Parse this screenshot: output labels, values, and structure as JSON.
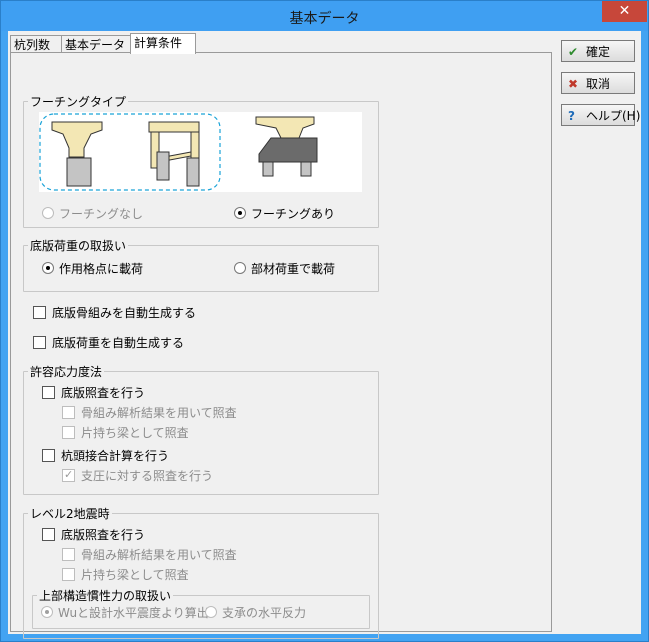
{
  "window": {
    "title": "基本データ",
    "close_glyph": "✕"
  },
  "tabs": [
    {
      "label": "杭列数"
    },
    {
      "label": "基本データ"
    },
    {
      "label": "計算条件"
    }
  ],
  "footing_type": {
    "title": "フーチングタイプ",
    "opt_none": "フーチングなし",
    "opt_yes": "フーチングあり",
    "selected": "フーチングあり"
  },
  "slab_load": {
    "title": "底版荷重の取扱い",
    "opt_node": "作用格点に載荷",
    "opt_member": "部材荷重で載荷",
    "selected": "作用格点に載荷"
  },
  "auto": {
    "frame": "底版骨組みを自動生成する",
    "load": "底版荷重を自動生成する"
  },
  "allowable": {
    "title": "許容応力度法",
    "slab_check": "底版照査を行う",
    "use_frame": "骨組み解析結果を用いて照査",
    "cantilever": "片持ち梁として照査",
    "pile_head": "杭頭接合計算を行う",
    "bearing": "支圧に対する照査を行う"
  },
  "level2": {
    "title": "レベル2地震時",
    "slab_check": "底版照査を行う",
    "use_frame": "骨組み解析結果を用いて照査",
    "cantilever": "片持ち梁として照査",
    "super_title": "上部構造慣性力の取扱い",
    "opt_wu": "Wuと設計水平震度より算出",
    "opt_bearing": "支承の水平反力"
  },
  "buttons": {
    "ok": "確定",
    "cancel": "取消",
    "help": "ヘルプ(H)"
  },
  "colors": {
    "title_bar": "#3f9ff2",
    "ok_icon": "#2e8b2e",
    "cancel_icon": "#c0392b",
    "help_icon": "#1e6bb8",
    "footing_fill": "#f3e7b4"
  }
}
